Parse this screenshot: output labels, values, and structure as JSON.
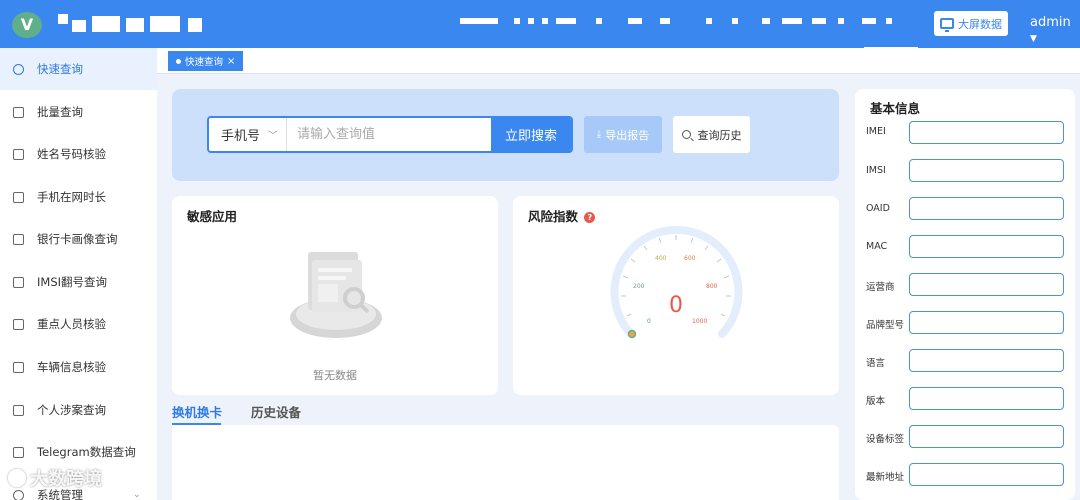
{
  "header": {
    "logo_letter": "V",
    "bigscreen_label": "大屏数据",
    "user_label": "admin",
    "brand_color": "#3b87f0"
  },
  "sidebar": {
    "items": [
      {
        "label": "快速查询",
        "icon": "search-icon",
        "active": true
      },
      {
        "label": "批量查询",
        "icon": "list-search-icon"
      },
      {
        "label": "姓名号码核验",
        "icon": "user-verify-icon"
      },
      {
        "label": "手机在网时长",
        "icon": "phone-icon"
      },
      {
        "label": "银行卡画像查询",
        "icon": "bank-card-icon"
      },
      {
        "label": "IMSI翻号查询",
        "icon": "sim-icon"
      },
      {
        "label": "重点人员核验",
        "icon": "person-icon"
      },
      {
        "label": "车辆信息核验",
        "icon": "car-icon"
      },
      {
        "label": "个人涉案查询",
        "icon": "document-icon"
      },
      {
        "label": "Telegram数据查询",
        "icon": "send-icon"
      },
      {
        "label": "系统管理",
        "icon": "gear-icon"
      }
    ]
  },
  "tabs": {
    "open_tab": "快速查询",
    "close_glyph": "×"
  },
  "search": {
    "type_selected": "手机号",
    "placeholder": "请输入查询值",
    "search_label": "立即搜索",
    "export_label": "导出报告",
    "history_label": "查询历史"
  },
  "sensitive_apps": {
    "title": "敏感应用",
    "empty_text": "暂无数据"
  },
  "risk": {
    "title": "风险指数",
    "help_glyph": "?",
    "value": "0",
    "ticks": [
      "0",
      "200",
      "400",
      "600",
      "800",
      "1000"
    ]
  },
  "lower_tabs": [
    "换机换卡",
    "历史设备"
  ],
  "basic_info": {
    "title": "基本信息",
    "fields": [
      {
        "label": "IMEI",
        "value": ""
      },
      {
        "label": "IMSI",
        "value": ""
      },
      {
        "label": "OAID",
        "value": ""
      },
      {
        "label": "MAC",
        "value": ""
      },
      {
        "label": "运营商",
        "value": ""
      },
      {
        "label": "品牌型号",
        "value": ""
      },
      {
        "label": "语言",
        "value": ""
      },
      {
        "label": "版本",
        "value": ""
      },
      {
        "label": "设备标签",
        "value": ""
      },
      {
        "label": "最新地址",
        "value": ""
      }
    ]
  },
  "watermark": "大数跨境"
}
